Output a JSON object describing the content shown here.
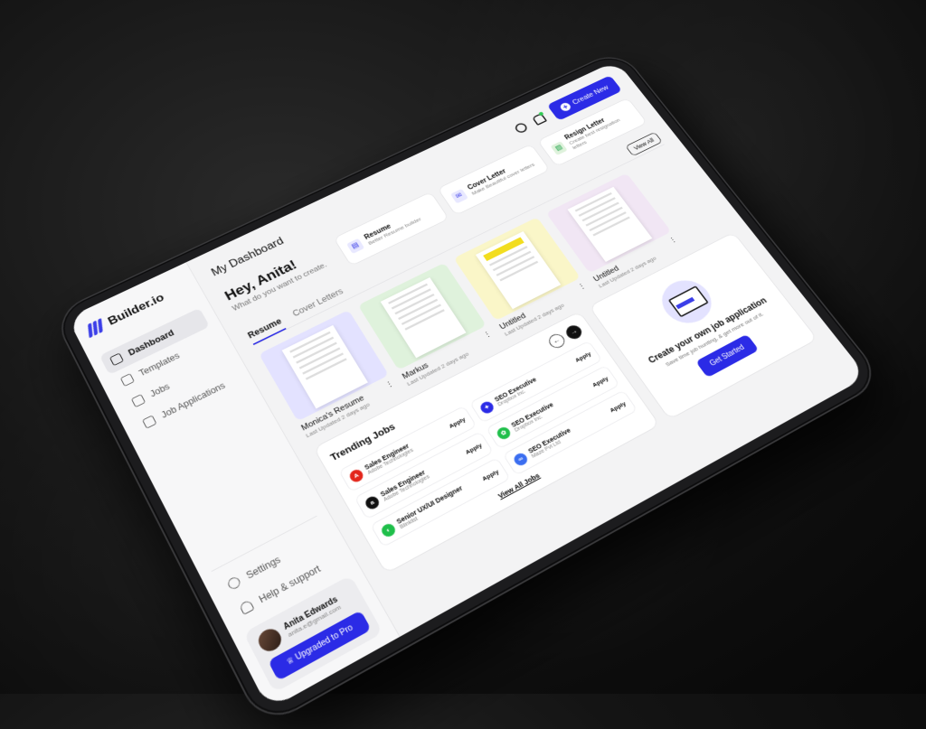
{
  "app": {
    "brand": "Builder.io",
    "page_title": "My Dashboard"
  },
  "sidebar": {
    "items": [
      {
        "label": "Dashboard",
        "icon": "home-icon",
        "active": true
      },
      {
        "label": "Templates",
        "icon": "template-icon",
        "active": false
      },
      {
        "label": "Jobs",
        "icon": "briefcase-icon",
        "active": false
      },
      {
        "label": "Job Applications",
        "icon": "monitor-icon",
        "active": false
      }
    ],
    "bottom": [
      {
        "label": "Settings",
        "icon": "gear-icon"
      },
      {
        "label": "Help & support",
        "icon": "headset-icon"
      }
    ],
    "profile": {
      "name": "Anita Edwards",
      "email": "anita.e@gmail.com",
      "upgrade_label": "Upgraded to Pro"
    }
  },
  "topbar": {
    "create_label": "Create New"
  },
  "greeting": {
    "title": "Hey, Anita!",
    "subtitle": "What do you want to create."
  },
  "quick_cards": [
    {
      "title": "Resume",
      "subtitle": "Better Resume builder"
    },
    {
      "title": "Cover Letter",
      "subtitle": "Make Beautiful cover letters"
    },
    {
      "title": "Resign Letter",
      "subtitle": "Create best resignation letters"
    }
  ],
  "tabs": [
    {
      "label": "Resume",
      "active": true
    },
    {
      "label": "Cover Letters",
      "active": false
    }
  ],
  "view_all_label": "View All",
  "resumes": [
    {
      "name": "Monica's Resume",
      "updated": "Last Updated 2 days ago",
      "tint": "#e3e2ff"
    },
    {
      "name": "Markus",
      "updated": "Last Updated 2 days ago",
      "tint": "#dff2dc"
    },
    {
      "name": "Untitled",
      "updated": "Last Updated 2 days ago",
      "tint": "#faf6c8"
    },
    {
      "name": "Untitled",
      "updated": "Last Updated 2 days ago",
      "tint": "#f1e6f4"
    }
  ],
  "jobs": {
    "title": "Trending Jobs",
    "view_all_label": "View All Jobs",
    "apply_label": "Apply",
    "items": [
      {
        "title": "Sales Engineer",
        "company": "Adobe Technologies",
        "logo_color": "#e3261b",
        "glyph": "A"
      },
      {
        "title": "SEO Executive",
        "company": "Dropbox Inc.",
        "logo_color": "#2b2be6",
        "glyph": "✦"
      },
      {
        "title": "Sales Engineer",
        "company": "Adobe Technologies",
        "logo_color": "#111111",
        "glyph": "a"
      },
      {
        "title": "SEO Executive",
        "company": "Dropbox Inc.",
        "logo_color": "#1fbf4a",
        "glyph": "✿"
      },
      {
        "title": "Senior UX/UI Designer",
        "company": "Blinklist",
        "logo_color": "#1fbf4a",
        "glyph": "◐"
      },
      {
        "title": "SEO Executive",
        "company": "Maze Pvt Ltd",
        "logo_color": "#3b6ef0",
        "glyph": "∞"
      }
    ]
  },
  "create_card": {
    "title": "Create your own job application",
    "subtitle": "Save time job hunting, & get more out of it.",
    "button_label": "Get Started"
  }
}
